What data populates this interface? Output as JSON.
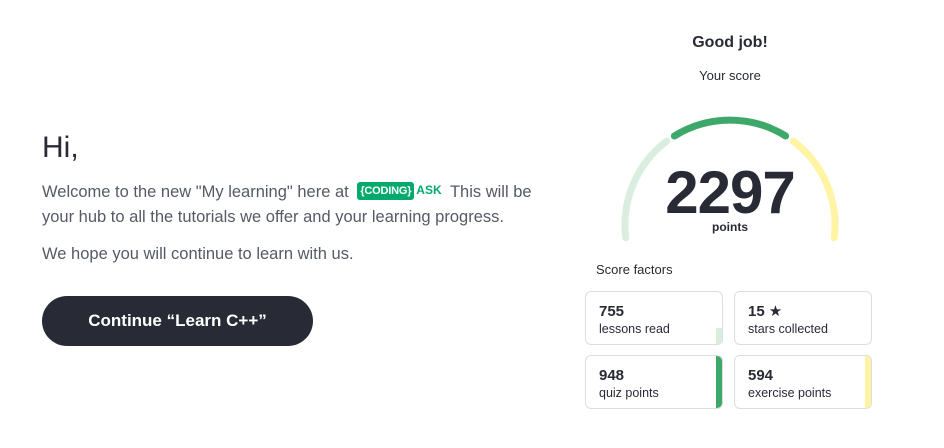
{
  "welcome_panel": {
    "greeting": "Hi,",
    "welcome_before": "Welcome to the new \"My learning\" here at",
    "brand_coding": "{CODING}",
    "brand_ask": "ASK",
    "welcome_after": "This will be your hub to all the tutorials we offer and your learning progress.",
    "hope_text": "We hope you will continue to learn with us.",
    "continue_label": "Continue “Learn C++”"
  },
  "score_panel": {
    "heading": "Good job!",
    "subheading": "Your score",
    "score": "2297",
    "unit": "points",
    "factors_label": "Score factors",
    "factors": [
      {
        "value": "755",
        "label": "lessons read",
        "icon": "",
        "color": "#d9eedf",
        "level": 0.3
      },
      {
        "value": "15",
        "label": "stars collected",
        "icon": "star-icon",
        "color": "#ffffff",
        "level": 0
      },
      {
        "value": "948",
        "label": "quiz points",
        "icon": "",
        "color": "#3ea86b",
        "level": 1
      },
      {
        "value": "594",
        "label": "exercise points",
        "icon": "",
        "color": "#fff4a3",
        "level": 1
      }
    ],
    "gauge_colors": {
      "left": "#d9eedf",
      "middle": "#3ea86b",
      "right": "#fff4a3"
    }
  }
}
